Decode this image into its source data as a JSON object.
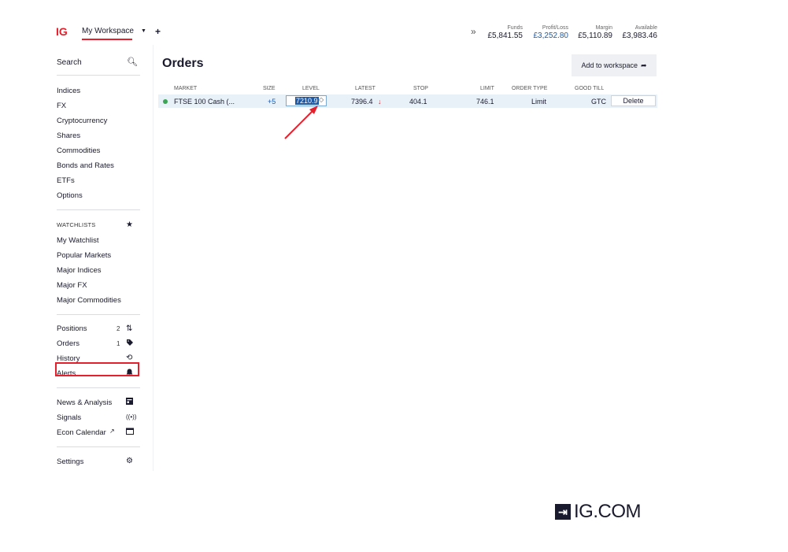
{
  "topbar": {
    "logo": "IG",
    "workspace": "My Workspace",
    "plus": "+",
    "chevrons": "»",
    "account": [
      {
        "label": "Funds",
        "value": "£5,841.55",
        "blue": false
      },
      {
        "label": "Profit/Loss",
        "value": "£3,252.80",
        "blue": true
      },
      {
        "label": "Margin",
        "value": "£5,110.89",
        "blue": false
      },
      {
        "label": "Available",
        "value": "£3,983.46",
        "blue": false
      }
    ]
  },
  "sidebar": {
    "search": "Search",
    "markets": [
      "Indices",
      "FX",
      "Cryptocurrency",
      "Shares",
      "Commodities",
      "Bonds and Rates",
      "ETFs",
      "Options"
    ],
    "watchlists_head": "WATCHLISTS",
    "watchlists": [
      "My Watchlist",
      "Popular Markets",
      "Major Indices",
      "Major FX",
      "Major Commodities"
    ],
    "account_items": [
      {
        "label": "Positions",
        "count": "2",
        "icon": "arrows-icon"
      },
      {
        "label": "Orders",
        "count": "1",
        "icon": "tag-icon"
      },
      {
        "label": "History",
        "count": "",
        "icon": "history-icon"
      },
      {
        "label": "Alerts",
        "count": "",
        "icon": "bell-icon"
      }
    ],
    "info_items": [
      {
        "label": "News & Analysis",
        "icon": "news-icon"
      },
      {
        "label": "Signals",
        "icon": "signal-icon"
      },
      {
        "label": "Econ Calendar",
        "icon": "calendar-icon"
      }
    ],
    "settings": "Settings"
  },
  "main": {
    "title": "Orders",
    "add_button": "Add to workspace",
    "columns": [
      "MARKET",
      "SIZE",
      "LEVEL",
      "LATEST",
      "STOP",
      "LIMIT",
      "ORDER TYPE",
      "GOOD TILL"
    ],
    "order": {
      "market": "FTSE 100 Cash (...",
      "size": "+5",
      "level": "7210.9",
      "latest": "7396.4",
      "latest_dir": "↓",
      "stop": "404.1",
      "limit": "746.1",
      "order_type": "Limit",
      "good_till": "GTC",
      "delete": "Delete"
    }
  },
  "brand": {
    "text": "IG.COM",
    "arrow": "⇥"
  },
  "colors": {
    "accent": "#e4202c",
    "blue": "#1f5aa6",
    "green": "#3aa655",
    "dark": "#1a1a2e"
  }
}
